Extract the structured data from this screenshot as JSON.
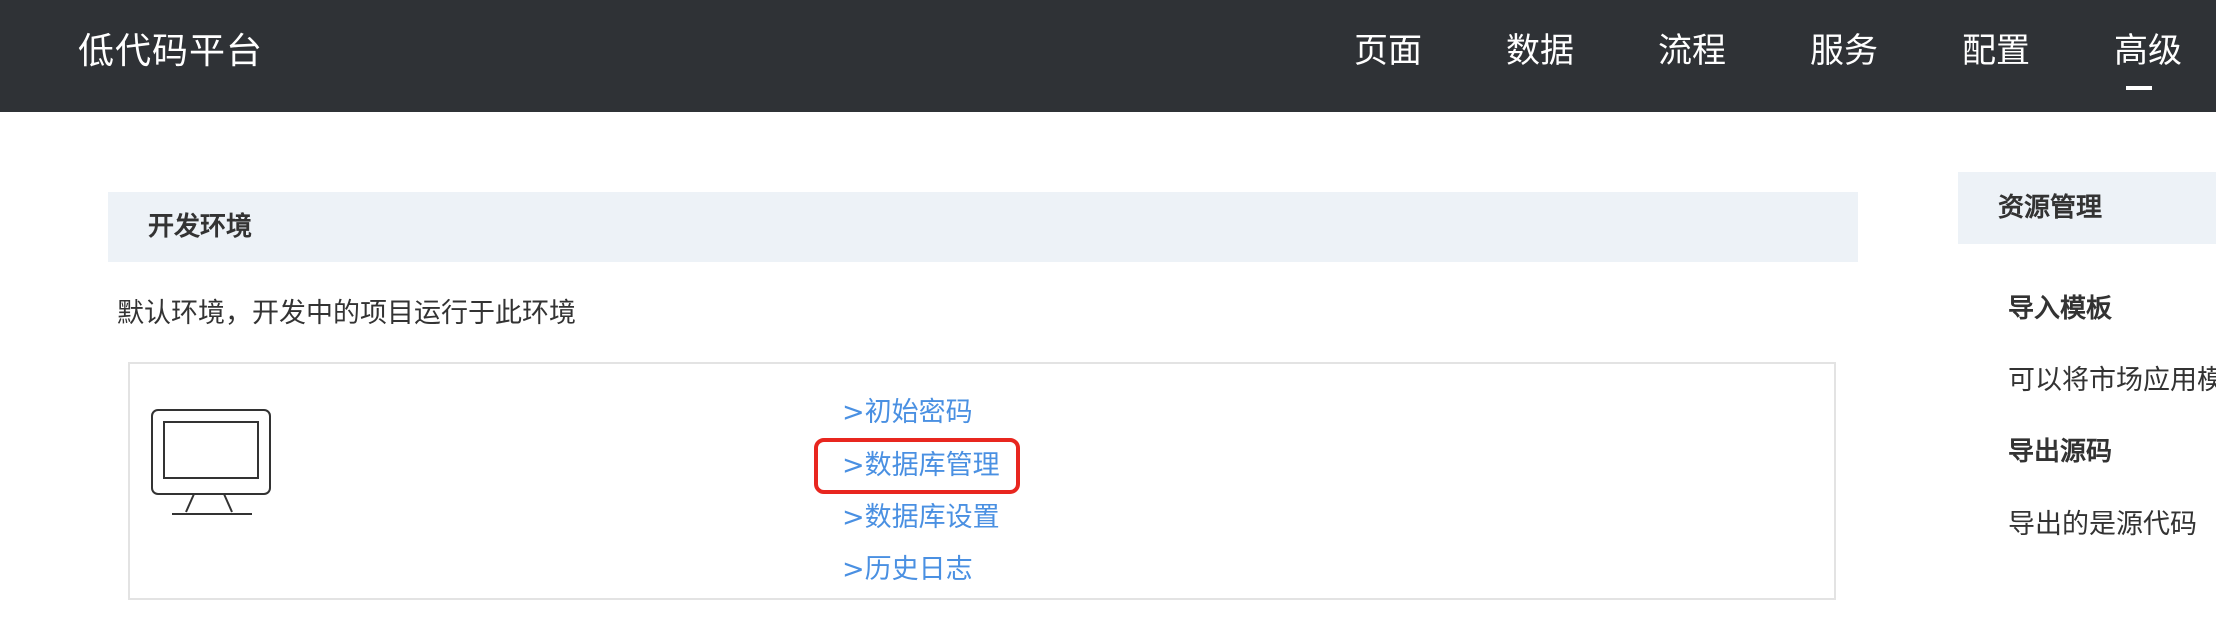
{
  "header": {
    "brand": "低代码平台",
    "nav": [
      {
        "label": "页面"
      },
      {
        "label": "数据"
      },
      {
        "label": "流程"
      },
      {
        "label": "服务"
      },
      {
        "label": "配置"
      },
      {
        "label": "高级",
        "active": true
      }
    ],
    "colors": {
      "background": "#2f3236",
      "text": "#ffffff"
    }
  },
  "main": {
    "section_title": "开发环境",
    "description": "默认环境，开发中的项目运行于此环境",
    "card": {
      "icon": "monitor-icon",
      "links": [
        {
          "label": ">初始密码"
        },
        {
          "label": ">数据库管理",
          "highlighted": true
        },
        {
          "label": ">数据库设置"
        },
        {
          "label": ">历史日志"
        }
      ],
      "link_color": "#4a90e2",
      "highlight_color": "#e8261f"
    }
  },
  "sidebar": {
    "title": "资源管理",
    "items": [
      {
        "heading": "导入模板",
        "text": "可以将市场应用模"
      },
      {
        "heading": "导出源码",
        "text": "导出的是源代码"
      }
    ]
  }
}
